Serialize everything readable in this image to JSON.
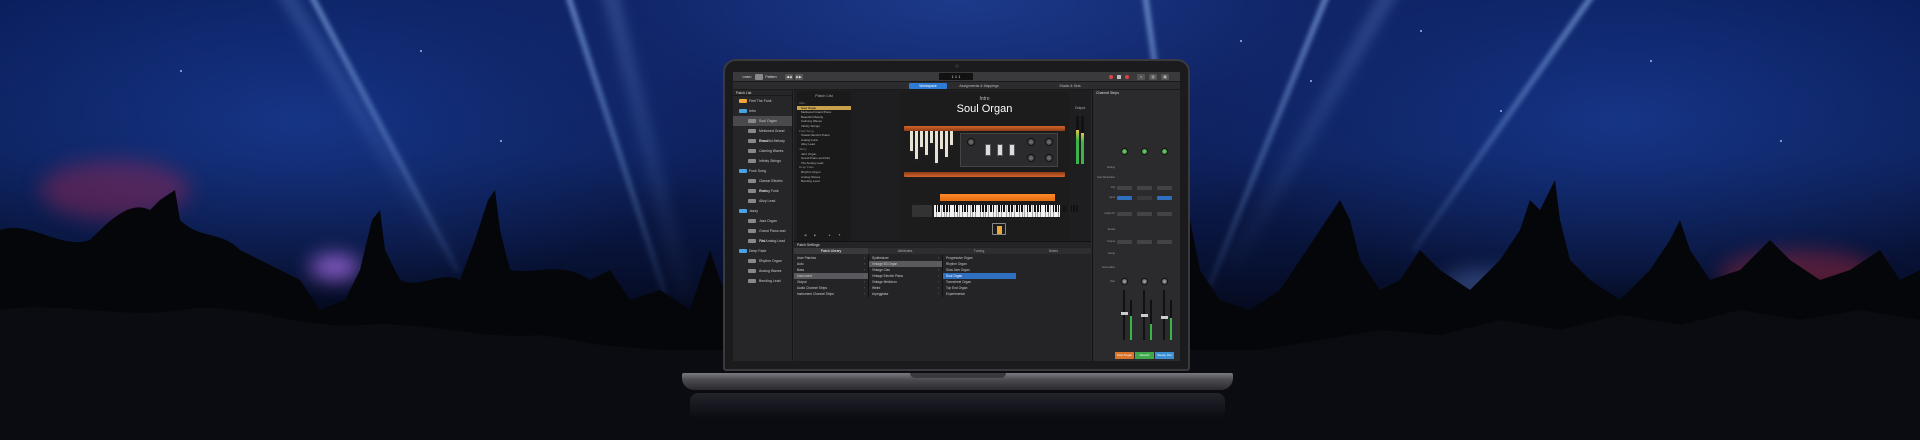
{
  "window": {
    "project_label": "Learn",
    "mode_label": "Pattern",
    "lcd_text": "1  1  1"
  },
  "tabs": [
    "Workspace",
    "Assignments & Mappings",
    "Studio & Sets"
  ],
  "patch_list": {
    "title": "Patch List",
    "items": [
      {
        "label": "Feel The Funk",
        "kind": "kit",
        "level": 0
      },
      {
        "label": "Intro",
        "kind": "folder",
        "level": 0
      },
      {
        "label": "Soul Organ",
        "kind": "patch",
        "level": 1,
        "selected": true
      },
      {
        "label": "Mellowed Grand Piano",
        "kind": "patch",
        "level": 1
      },
      {
        "label": "Beautiful Melody",
        "kind": "patch",
        "level": 1
      },
      {
        "label": "Calming Waves",
        "kind": "patch",
        "level": 1
      },
      {
        "label": "Infinity Strings",
        "kind": "patch",
        "level": 1
      },
      {
        "label": "Funk Song",
        "kind": "folder",
        "level": 0
      },
      {
        "label": "Classic Electric Piano",
        "kind": "patch",
        "level": 1
      },
      {
        "label": "Analog Funk",
        "kind": "patch",
        "level": 1
      },
      {
        "label": "Alloy Lead",
        "kind": "patch",
        "level": 1
      },
      {
        "label": "Jazzy",
        "kind": "folder",
        "level": 0
      },
      {
        "label": "Jazz Organ",
        "kind": "patch",
        "level": 1
      },
      {
        "label": "Grand Piano and Pad",
        "kind": "patch",
        "level": 1
      },
      {
        "label": "70s Analog Lead",
        "kind": "patch",
        "level": 1
      },
      {
        "label": "Deep Fade",
        "kind": "folder",
        "level": 0
      },
      {
        "label": "Rhythm Organ",
        "kind": "patch",
        "level": 1
      },
      {
        "label": "Analog Waves",
        "kind": "patch",
        "level": 1
      },
      {
        "label": "Bending Lead",
        "kind": "patch",
        "level": 1
      }
    ]
  },
  "plugin": {
    "sidelist_title": "Patch List",
    "sidelist": [
      {
        "label": "Intro",
        "cat": true
      },
      {
        "label": "Soul Organ",
        "sel": true
      },
      {
        "label": "Mellowed Grand Piano"
      },
      {
        "label": "Beautiful Melody"
      },
      {
        "label": "Calming Waves"
      },
      {
        "label": "Infinity Strings"
      },
      {
        "label": "Funk Song",
        "cat": true
      },
      {
        "label": "Classic Electric Piano"
      },
      {
        "label": "Analog Funk"
      },
      {
        "label": "Alloy Lead"
      },
      {
        "label": "Jazzy",
        "cat": true
      },
      {
        "label": "Jazz Organ"
      },
      {
        "label": "Grand Piano and Pad"
      },
      {
        "label": "70s Analog Lead"
      },
      {
        "label": "Deep Fade",
        "cat": true
      },
      {
        "label": "Rhythm Organ"
      },
      {
        "label": "Analog Waves"
      },
      {
        "label": "Bending Lead"
      }
    ],
    "subtitle": "Intro",
    "title": "Soul Organ",
    "manual_label": "Organ",
    "output_label": "Output"
  },
  "patch_settings": {
    "title": "Patch Settings",
    "tabs": [
      "Patch Library",
      "Attributes",
      "Tuning",
      "Notes"
    ],
    "col1": [
      {
        "label": "User Patches"
      },
      {
        "label": "Auto"
      },
      {
        "label": "Bass"
      },
      {
        "label": "Instrument",
        "sel": true
      },
      {
        "label": "Output"
      },
      {
        "label": "Audio Channel Strips"
      },
      {
        "label": "Instrument Channel Strips"
      }
    ],
    "col2": [
      {
        "label": "Synthesizer"
      },
      {
        "label": "Vintage B3 Organ",
        "sel": true
      },
      {
        "label": "Vintage Clav"
      },
      {
        "label": "Vintage Electric Piano"
      },
      {
        "label": "Vintage Mellotron"
      },
      {
        "label": "Weird"
      },
      {
        "label": "Arpeggiator"
      }
    ],
    "col3": [
      {
        "label": "Progressive Organ"
      },
      {
        "label": "Rhythm Organ"
      },
      {
        "label": "Slow Jam Organ"
      },
      {
        "label": "Soul Organ",
        "sel": true
      },
      {
        "label": "Tonewheel Organ"
      },
      {
        "label": "Top End Organ"
      },
      {
        "label": "Experimental"
      }
    ]
  },
  "channel_strips": {
    "title": "Channel Strips",
    "labels": [
      "Setting",
      "Gain Reduction",
      "EQ",
      "Input",
      "Audio FX",
      "Sends",
      "Output",
      "Group",
      "Automation",
      "Pan"
    ],
    "strip_names": [
      "Soul Organ",
      "Reverb",
      "Stereo Out"
    ],
    "strip_colors": [
      "#d8732a",
      "#3fa84a",
      "#3b8fd0"
    ]
  }
}
